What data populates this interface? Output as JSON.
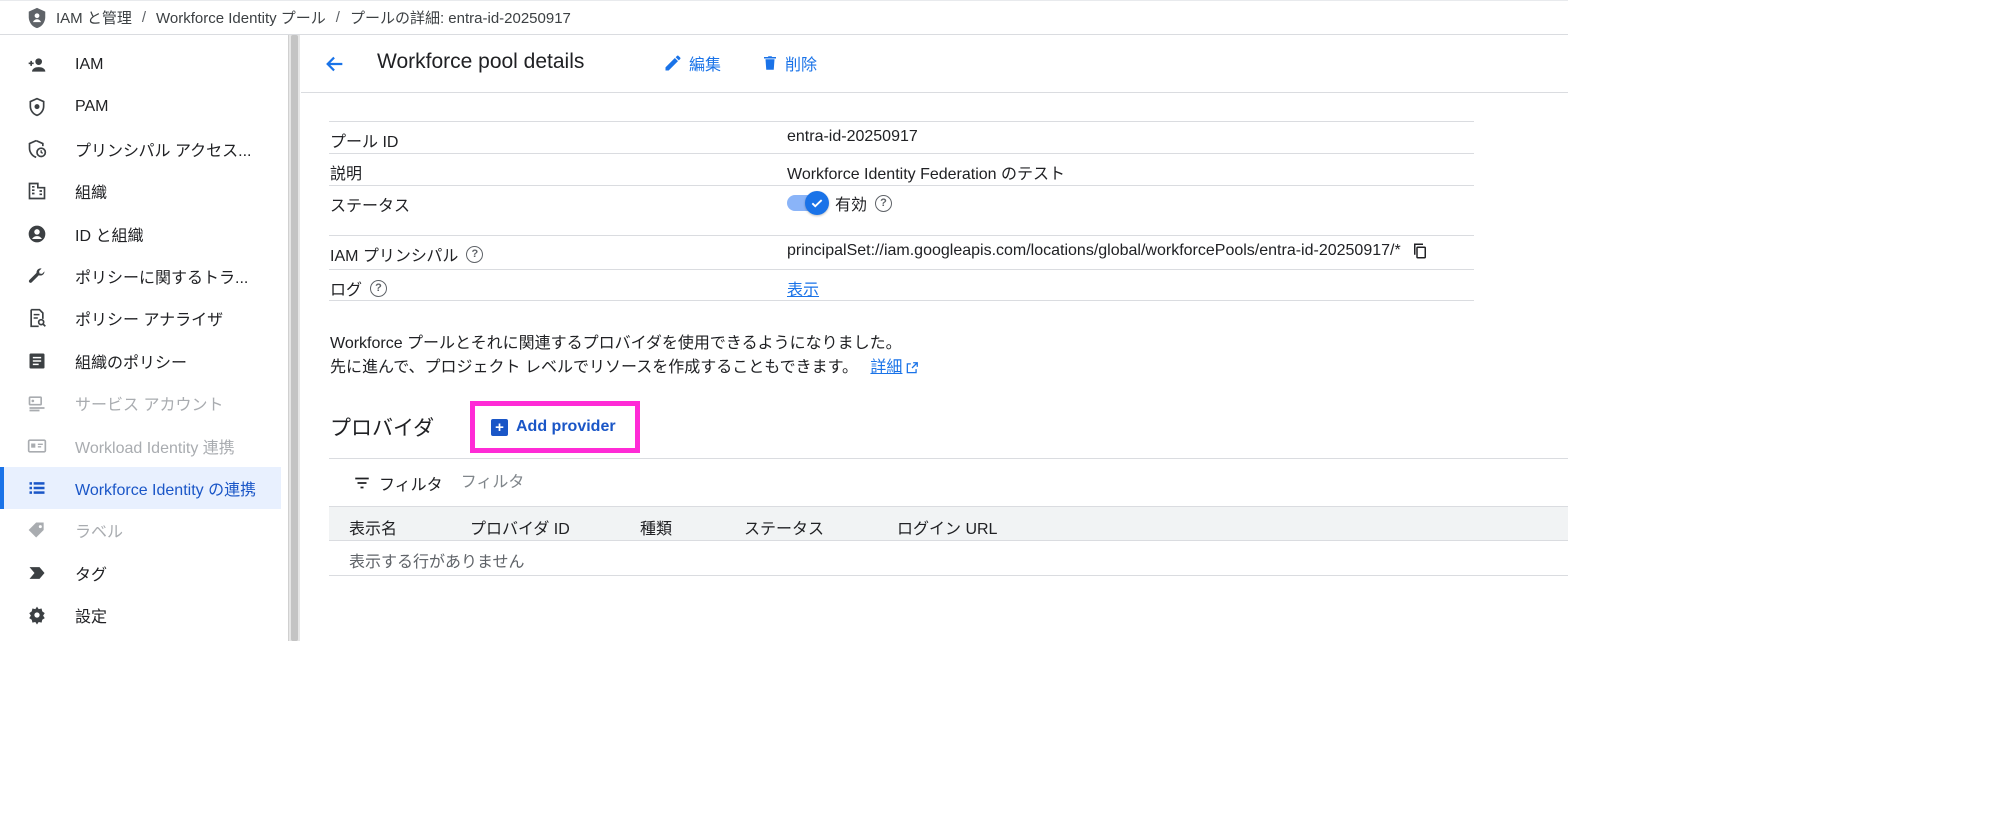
{
  "breadcrumb": {
    "items": [
      "IAM と管理",
      "Workforce Identity プール",
      "プールの詳細: entra-id-20250917"
    ],
    "separator": "/"
  },
  "sidebar": {
    "items": [
      {
        "label": "IAM",
        "icon": "person-add-icon",
        "state": "normal"
      },
      {
        "label": "PAM",
        "icon": "shield-gear-icon",
        "state": "normal"
      },
      {
        "label": "プリンシパル アクセス...",
        "icon": "shield-clock-icon",
        "state": "normal"
      },
      {
        "label": "組織",
        "icon": "building-icon",
        "state": "normal"
      },
      {
        "label": "ID と組織",
        "icon": "account-circle-icon",
        "state": "normal"
      },
      {
        "label": "ポリシーに関するトラ...",
        "icon": "wrench-icon",
        "state": "normal"
      },
      {
        "label": "ポリシー アナライザ",
        "icon": "document-search-icon",
        "state": "normal"
      },
      {
        "label": "組織のポリシー",
        "icon": "article-icon",
        "state": "normal"
      },
      {
        "label": "サービス アカウント",
        "icon": "service-account-icon",
        "state": "disabled"
      },
      {
        "label": "Workload Identity 連携",
        "icon": "id-card-icon",
        "state": "disabled"
      },
      {
        "label": "Workforce Identity の連携",
        "icon": "list-icon",
        "state": "active"
      },
      {
        "label": "ラベル",
        "icon": "tag-icon",
        "state": "disabled"
      },
      {
        "label": "タグ",
        "icon": "chevron-tag-icon",
        "state": "normal"
      },
      {
        "label": "設定",
        "icon": "gear-icon",
        "state": "normal"
      }
    ]
  },
  "header": {
    "title": "Workforce pool details",
    "edit_label": "編集",
    "delete_label": "削除"
  },
  "details": {
    "pool_id_key": "プール ID",
    "pool_id_value": "entra-id-20250917",
    "description_key": "説明",
    "description_value": "Workforce Identity Federation のテスト",
    "status_key": "ステータス",
    "status_value": "有効",
    "status_enabled": true,
    "principal_key": "IAM プリンシパル",
    "principal_value": "principalSet://iam.googleapis.com/locations/global/workforcePools/entra-id-20250917/*",
    "log_key": "ログ",
    "log_value": "表示"
  },
  "info": {
    "line1": "Workforce プールとそれに関連するプロバイダを使用できるようになりました。",
    "line2": "先に進んで、プロジェクト レベルでリソースを作成することもできます。",
    "learn_more": "詳細"
  },
  "providers": {
    "title": "プロバイダ",
    "add_label": "Add provider",
    "filter_label": "フィルタ",
    "filter_placeholder": "フィルタ",
    "columns": [
      "表示名",
      "プロバイダ ID",
      "種類",
      "ステータス",
      "ログイン URL"
    ],
    "empty_text": "表示する行がありません"
  },
  "colors": {
    "accent": "#1a73e8",
    "highlight": "#ff2bd6",
    "active_bg": "#e8f0fe"
  }
}
